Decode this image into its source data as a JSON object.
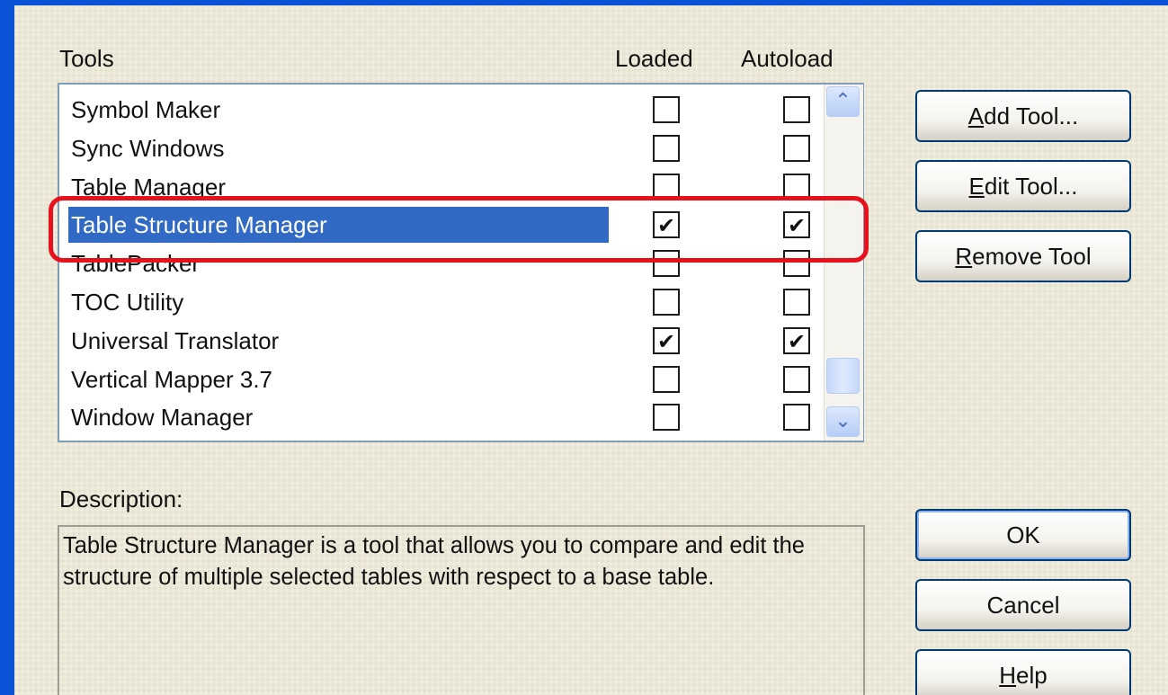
{
  "headers": {
    "tools": "Tools",
    "loaded": "Loaded",
    "autoload": "Autoload"
  },
  "tools": [
    {
      "name": "Symbol Maker",
      "loaded": false,
      "autoload": false,
      "selected": false
    },
    {
      "name": "Sync Windows",
      "loaded": false,
      "autoload": false,
      "selected": false
    },
    {
      "name": "Table Manager",
      "loaded": false,
      "autoload": false,
      "selected": false
    },
    {
      "name": "Table Structure Manager",
      "loaded": true,
      "autoload": true,
      "selected": true
    },
    {
      "name": "TablePacker",
      "loaded": false,
      "autoload": false,
      "selected": false
    },
    {
      "name": "TOC Utility",
      "loaded": false,
      "autoload": false,
      "selected": false
    },
    {
      "name": "Universal Translator",
      "loaded": true,
      "autoload": true,
      "selected": false
    },
    {
      "name": "Vertical Mapper 3.7",
      "loaded": false,
      "autoload": false,
      "selected": false
    },
    {
      "name": "Window Manager",
      "loaded": false,
      "autoload": false,
      "selected": false
    }
  ],
  "buttons": {
    "add_tool": {
      "label": "Add Tool...",
      "underline_index": 0
    },
    "edit_tool": {
      "label": "Edit Tool...",
      "underline_index": 0
    },
    "remove_tool": {
      "label": "Remove Tool",
      "underline_index": 0
    },
    "ok": {
      "label": "OK"
    },
    "cancel": {
      "label": "Cancel"
    },
    "help": {
      "label": "Help",
      "underline_index": 0
    }
  },
  "description": {
    "label": "Description:",
    "text": "Table Structure Manager is a tool that allows you to compare and edit the structure of multiple selected tables with respect to a base table."
  },
  "colors": {
    "selection": "#316ac5",
    "highlight_box": "#e8111b",
    "window_frame": "#0a53d6",
    "dialog_bg": "#ece9d8"
  },
  "icons": {
    "scroll_up": "chevron-up-icon",
    "scroll_down": "chevron-down-icon",
    "check": "checkmark-icon"
  }
}
